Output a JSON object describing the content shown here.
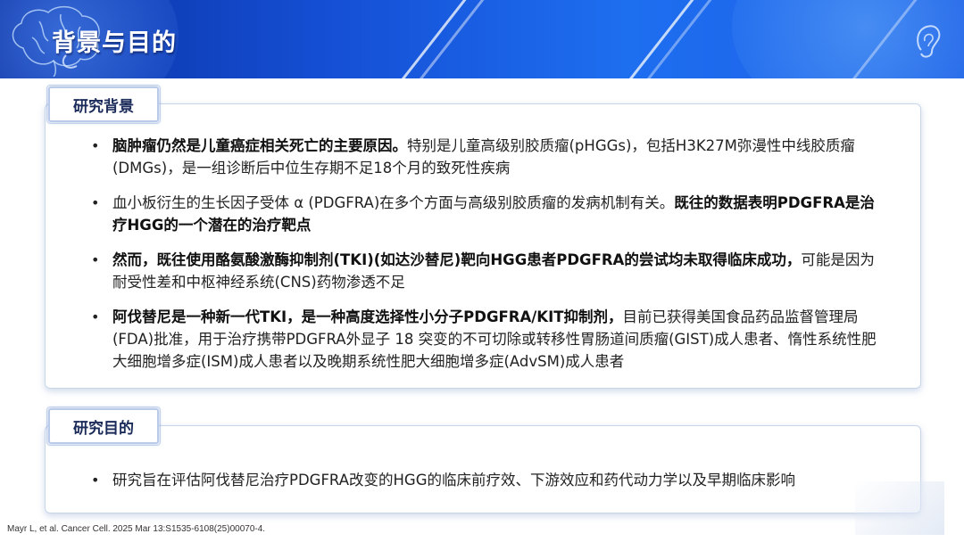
{
  "header": {
    "title": "背景与目的",
    "icons": [
      "brain-icon",
      "ear-icon"
    ],
    "colors": {
      "banner_start": "#0b2f9e",
      "banner_end": "#1e6ef0"
    }
  },
  "background_section": {
    "tab_label": "研究背景",
    "items": [
      {
        "bold": "脑肿瘤仍然是儿童癌症相关死亡的主要原因。",
        "text": "特别是儿童高级别胶质瘤(pHGGs)，包括H3K27M弥漫性中线胶质瘤(DMGs)，是一组诊断后中位生存期不足18个月的致死性疾病",
        "bold_tail": ""
      },
      {
        "bold": "",
        "text": "血小板衍生的生长因子受体 α (PDGFRA)在多个方面与高级别胶质瘤的发病机制有关。",
        "bold_tail": "既往的数据表明PDGFRA是治疗HGG的一个潜在的治疗靶点"
      },
      {
        "bold": "然而，既往使用酪氨酸激酶抑制剂(TKI)(如达沙替尼)靶向HGG患者PDGFRA的尝试均未取得临床成功，",
        "text": "可能是因为耐受性差和中枢神经系统(CNS)药物渗透不足",
        "bold_tail": ""
      },
      {
        "bold": "阿伐替尼是一种新一代TKI，是一种高度选择性小分子PDGFRA/KIT抑制剂，",
        "text": "目前已获得美国食品药品监督管理局(FDA)批准，用于治疗携带PDGFRA外显子 18 突变的不可切除或转移性胃肠道间质瘤(GIST)成人患者、惰性系统性肥大细胞增多症(ISM)成人患者以及晚期系统性肥大细胞增多症(AdvSM)成人患者",
        "bold_tail": ""
      }
    ]
  },
  "objective_section": {
    "tab_label": "研究目的",
    "items": [
      {
        "text": "研究旨在评估阿伐替尼治疗PDGFRA改变的HGG的临床前疗效、下游效应和药代动力学以及早期临床影响"
      }
    ]
  },
  "citation": "Mayr L, et al. Cancer Cell. 2025 Mar 13:S1535-6108(25)00070-4."
}
